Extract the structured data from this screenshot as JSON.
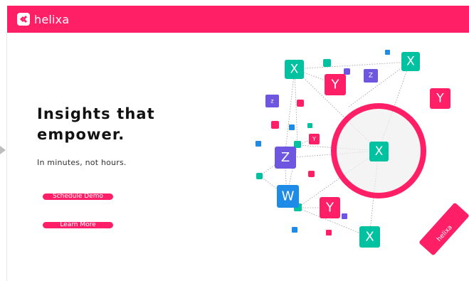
{
  "navbar": {
    "brand": "helixa",
    "background": "#ff1f66"
  },
  "hero": {
    "headline_line1": "Insights that",
    "headline_line2": "empower.",
    "subheadline": "In minutes, not hours.",
    "primary_button": "Schedule Demo",
    "secondary_button": "Learn More"
  },
  "illustration": {
    "center_tile": "X",
    "tiles": [
      "X",
      "X",
      "Y",
      "Y",
      "Y",
      "Y",
      "Z",
      "Z",
      "z",
      "W",
      "X"
    ],
    "magnifier_label": "helixa",
    "colors": {
      "pink": "#ff1f66",
      "teal": "#00c2a0",
      "purple": "#6e56e0",
      "blue": "#1e8be6"
    }
  }
}
